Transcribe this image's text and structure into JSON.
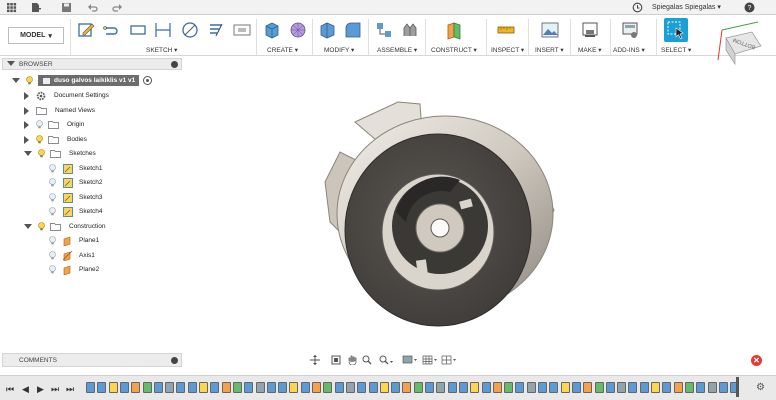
{
  "topbar": {
    "user_name": "Spiegalas Spiegalas ▾",
    "help_label": "?"
  },
  "toolbar": {
    "workspace_label": "MODEL",
    "groups": [
      "SKETCH ▾",
      "CREATE ▾",
      "MODIFY ▾",
      "ASSEMBLE ▾",
      "CONSTRUCT ▾",
      "INSPECT ▾",
      "INSERT ▾",
      "MAKE ▾",
      "ADD-INS ▾",
      "SELECT ▾"
    ]
  },
  "viewcube": {
    "label": "BOTTOM"
  },
  "browser": {
    "title": "BROWSER",
    "document_name": "duso galvos laikiklis v1 v1",
    "items": [
      {
        "label": "Document Settings"
      },
      {
        "label": "Named Views"
      },
      {
        "label": "Origin"
      },
      {
        "label": "Bodies"
      },
      {
        "label": "Sketches"
      },
      {
        "label": "Sketch1"
      },
      {
        "label": "Sketch2"
      },
      {
        "label": "Sketch3"
      },
      {
        "label": "Sketch4"
      },
      {
        "label": "Construction"
      },
      {
        "label": "Plane1"
      },
      {
        "label": "Axis1"
      },
      {
        "label": "Plane2"
      }
    ]
  },
  "comments": {
    "label": "COMMENTS"
  },
  "colors": {
    "accent_select": "#1a9fd6",
    "sketch_icon": "#ffd54f",
    "construction_icon": "#f5a04a",
    "model_dark": "#4b4845",
    "model_light": "#dcd7cf",
    "error": "#e53935"
  }
}
